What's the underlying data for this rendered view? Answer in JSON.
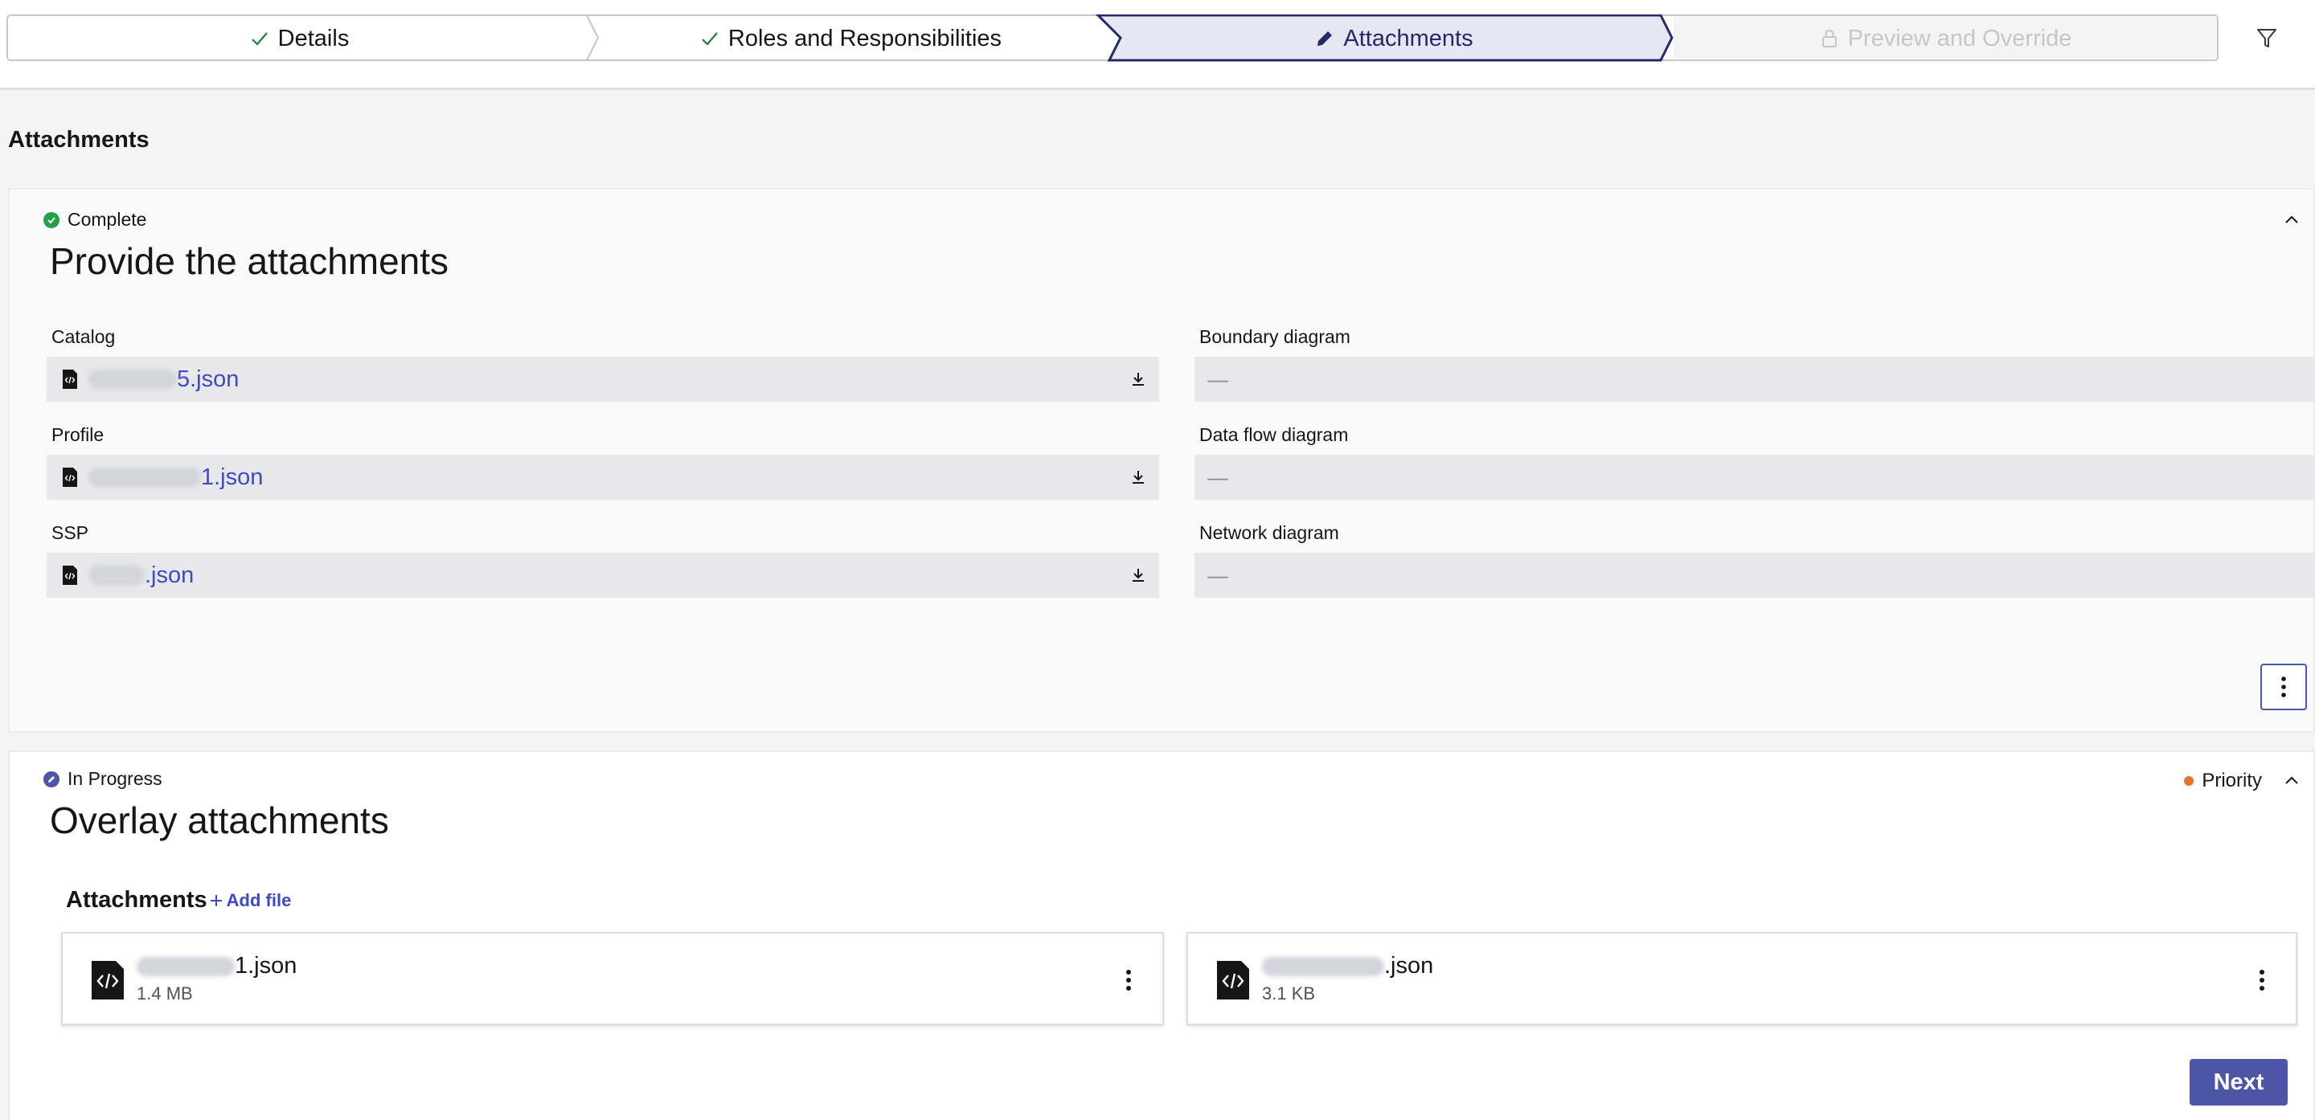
{
  "stepper": {
    "steps": [
      {
        "label": "Details",
        "state": "done"
      },
      {
        "label": "Roles and Responsibilities",
        "state": "done"
      },
      {
        "label": "Attachments",
        "state": "active"
      },
      {
        "label": "Preview and Override",
        "state": "locked"
      }
    ],
    "filter_icon": "filter-icon"
  },
  "page": {
    "title": "Attachments"
  },
  "section1": {
    "status": "Complete",
    "title": "Provide the attachments",
    "left_fields": [
      {
        "label": "Catalog",
        "file_suffix": "5.json"
      },
      {
        "label": "Profile",
        "file_suffix": "1.json"
      },
      {
        "label": "SSP",
        "file_suffix": ".json"
      }
    ],
    "right_fields": [
      {
        "label": "Boundary diagram",
        "value": "—"
      },
      {
        "label": "Data flow diagram",
        "value": "—"
      },
      {
        "label": "Network diagram",
        "value": "—"
      }
    ]
  },
  "section2": {
    "status": "In Progress",
    "priority": "Priority",
    "title": "Overlay attachments",
    "attachments_heading": "Attachments",
    "add_file": "Add file",
    "files": [
      {
        "name_suffix": "1.json",
        "size": "1.4 MB"
      },
      {
        "name_suffix": ".json",
        "size": "3.1 KB"
      }
    ],
    "next_label": "Next"
  },
  "colors": {
    "accent": "#4c55a6",
    "link": "#3d4ac6",
    "complete": "#24a148",
    "priority": "#e8712b"
  }
}
